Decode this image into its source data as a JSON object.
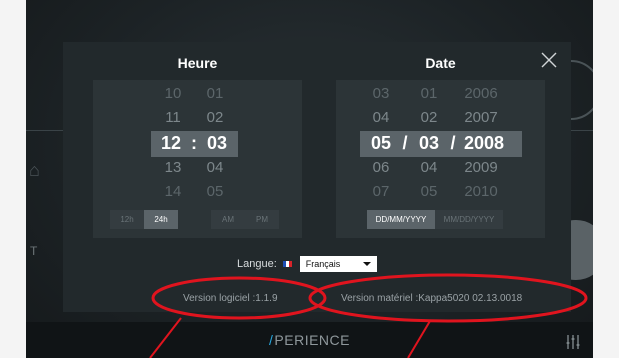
{
  "modal": {
    "time": {
      "title": "Heure",
      "rows": [
        {
          "hour": "10",
          "minute": "01"
        },
        {
          "hour": "11",
          "minute": "02"
        },
        {
          "hour": "12",
          "minute": "03"
        },
        {
          "hour": "13",
          "minute": "04"
        },
        {
          "hour": "14",
          "minute": "05"
        }
      ],
      "separator": ":",
      "format_12": "12h",
      "format_24": "24h",
      "am": "AM",
      "pm": "PM"
    },
    "date": {
      "title": "Date",
      "rows": [
        {
          "day": "03",
          "month": "01",
          "year": "2006"
        },
        {
          "day": "04",
          "month": "02",
          "year": "2007"
        },
        {
          "day": "05",
          "month": "03",
          "year": "2008"
        },
        {
          "day": "06",
          "month": "04",
          "year": "2009"
        },
        {
          "day": "07",
          "month": "05",
          "year": "2010"
        }
      ],
      "separator": "/",
      "format_dmy": "DD/MM/YYYY",
      "format_mdy": "MM/DD/YYYY"
    },
    "language": {
      "label": "Langue:",
      "value": "Français"
    },
    "software_version": "Version logiciel :1.1.9",
    "hardware_version": "Version matériel :Kappa5020 02.13.0018"
  },
  "bottom_bar": {
    "brand": "PERIENCE"
  },
  "colors": {
    "accent": "#27a9e1",
    "annotation": "#e0141e",
    "flag_blue": "#1f4fb5",
    "flag_red": "#d8232a"
  },
  "icons": {
    "close": "close-icon",
    "equalizer": "equalizer-icon"
  }
}
